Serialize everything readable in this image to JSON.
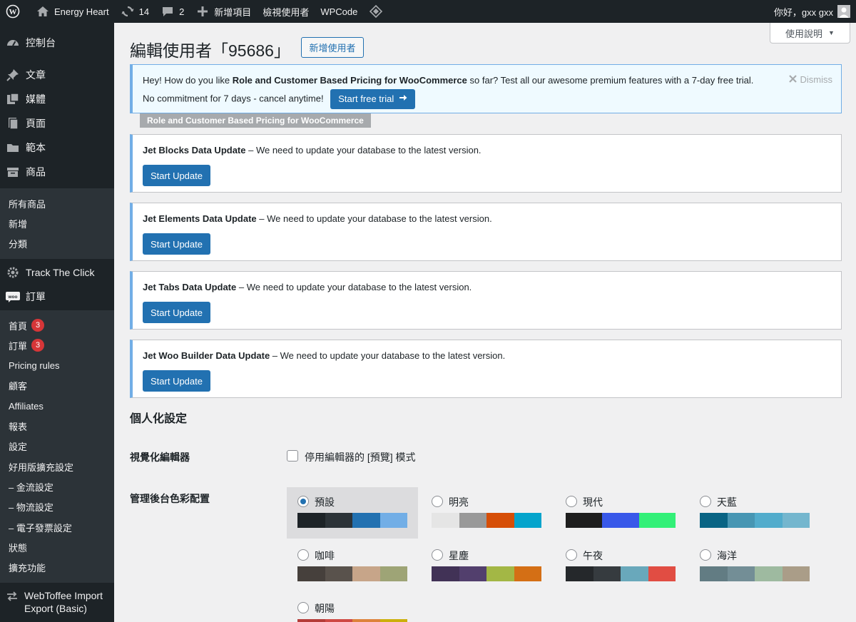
{
  "admin_bar": {
    "site_name": "Energy Heart",
    "updates_count": "14",
    "comments_count": "2",
    "new_item": "新增項目",
    "view_user": "檢視使用者",
    "wpcode": "WPCode",
    "greeting": "你好，gxx gxx"
  },
  "sidebar": {
    "top_items": [
      {
        "label": "控制台",
        "icon": "dashboard-icon"
      },
      {
        "label": "文章",
        "icon": "pin-icon"
      },
      {
        "label": "媒體",
        "icon": "media-icon"
      },
      {
        "label": "頁面",
        "icon": "page-icon"
      },
      {
        "label": "範本",
        "icon": "folder-icon"
      },
      {
        "label": "商品",
        "icon": "archive-icon"
      }
    ],
    "products_sub": [
      "所有商品",
      "新增",
      "分類"
    ],
    "track_the_click": "Track The Click",
    "orders": "訂單",
    "woo_sub": [
      {
        "label": "首頁",
        "badge": "3"
      },
      {
        "label": "訂單",
        "badge": "3"
      },
      {
        "label": "Pricing rules"
      },
      {
        "label": "顧客"
      },
      {
        "label": "Affiliates"
      },
      {
        "label": "報表"
      },
      {
        "label": "設定"
      },
      {
        "label": "好用版擴充設定"
      },
      {
        "label": "– 金流設定"
      },
      {
        "label": "– 物流設定"
      },
      {
        "label": "– 電子發票設定"
      },
      {
        "label": "狀態"
      },
      {
        "label": "擴充功能"
      }
    ],
    "webtoffee": "WebToffee Import Export (Basic)"
  },
  "help_tab": "使用說明",
  "page": {
    "title": "編輯使用者「95686」",
    "add_new": "新增使用者"
  },
  "promo": {
    "text_before": "Hey! How do you like ",
    "plugin_bold": "Role and Customer Based Pricing for WooCommerce",
    "text_after": " so far? Test all our awesome premium features with a 7-day free trial.",
    "line2": "No commitment for 7 days - cancel anytime!",
    "trial_button": "Start free trial",
    "dismiss": "Dismiss",
    "tag": "Role and Customer Based Pricing for WooCommerce"
  },
  "update_notices": [
    {
      "title": "Jet Blocks Data Update",
      "text": " – We need to update your database to the latest version.",
      "button": "Start Update"
    },
    {
      "title": "Jet Elements Data Update",
      "text": " – We need to update your database to the latest version.",
      "button": "Start Update"
    },
    {
      "title": "Jet Tabs Data Update",
      "text": " – We need to update your database to the latest version.",
      "button": "Start Update"
    },
    {
      "title": "Jet Woo Builder Data Update",
      "text": " – We need to update your database to the latest version.",
      "button": "Start Update"
    }
  ],
  "personal": {
    "section_title": "個人化設定",
    "visual_editor_label": "視覺化編輯器",
    "visual_editor_checkbox": "停用編輯器的 [預覽] 模式",
    "color_scheme_label": "管理後台色彩配置"
  },
  "color_schemes": [
    {
      "name": "預設",
      "selected": true,
      "colors": [
        "#1d2327",
        "#2c3338",
        "#2271b1",
        "#72aee6"
      ]
    },
    {
      "name": "明亮",
      "selected": false,
      "colors": [
        "#e5e5e5",
        "#999999",
        "#d64e07",
        "#04a4cc"
      ]
    },
    {
      "name": "現代",
      "selected": false,
      "colors": [
        "#1e1e1e",
        "#3858e9",
        "#33f078"
      ]
    },
    {
      "name": "天藍",
      "selected": false,
      "colors": [
        "#096484",
        "#4796b3",
        "#52accc",
        "#74b6ce"
      ]
    },
    {
      "name": "咖啡",
      "selected": false,
      "colors": [
        "#46403c",
        "#59524c",
        "#c7a589",
        "#9ea476"
      ]
    },
    {
      "name": "星塵",
      "selected": false,
      "colors": [
        "#413256",
        "#523f6d",
        "#a3b745",
        "#d46f15"
      ]
    },
    {
      "name": "午夜",
      "selected": false,
      "colors": [
        "#25282b",
        "#363b3f",
        "#69a8bb",
        "#e14d43"
      ]
    },
    {
      "name": "海洋",
      "selected": false,
      "colors": [
        "#627c83",
        "#738e96",
        "#9ebaa0",
        "#aa9d88"
      ]
    },
    {
      "name": "朝陽",
      "selected": false,
      "colors": [
        "#b43c38",
        "#cf4944",
        "#dd823b",
        "#ccaf0b"
      ]
    }
  ]
}
